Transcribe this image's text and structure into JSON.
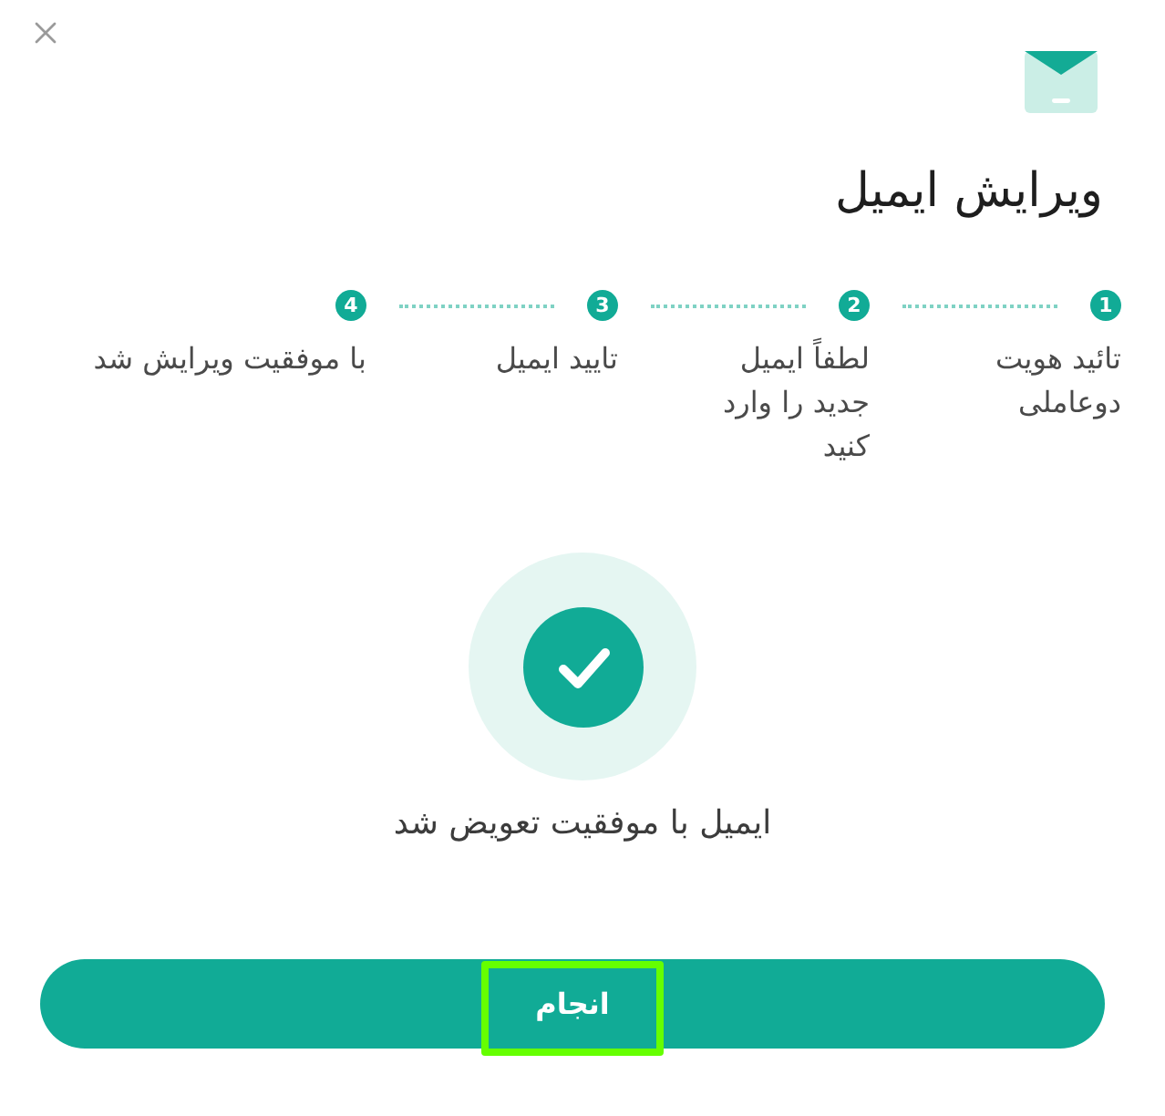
{
  "dialog": {
    "title": "ویرایش ایمیل"
  },
  "steps": [
    {
      "number": "1",
      "label": "تائید هویت دوعاملی",
      "completed": true
    },
    {
      "number": "2",
      "label": "لطفاً ایمیل جدید را وارد کنید",
      "completed": true
    },
    {
      "number": "3",
      "label": "تایید ایمیل",
      "completed": true
    },
    {
      "number": "4",
      "label": "با موفقیت ویرایش شد",
      "completed": true
    }
  ],
  "result": {
    "message": "ایمیل با موفقیت تعویض شد"
  },
  "button": {
    "label": "انجام",
    "highlighted": true
  }
}
